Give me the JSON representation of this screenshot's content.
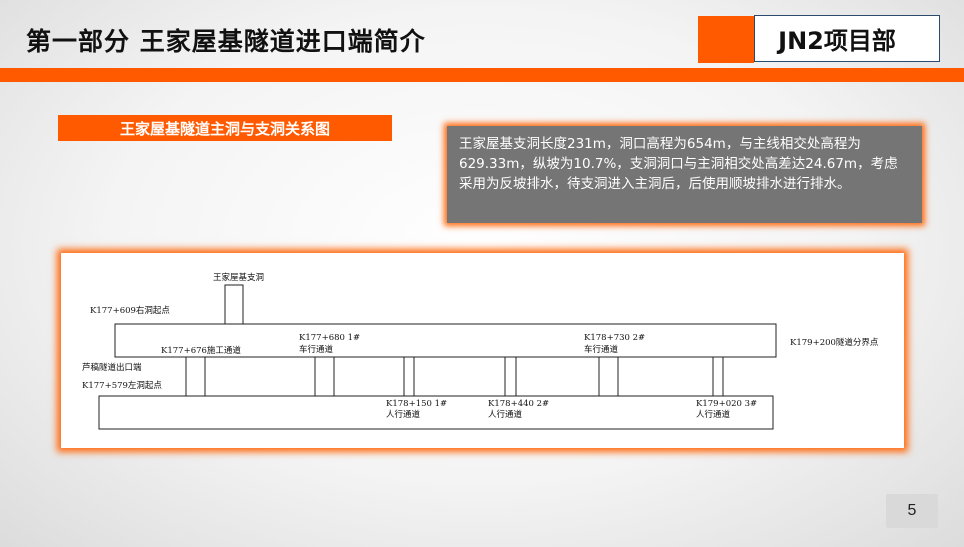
{
  "header": {
    "title": "第一部分  王家屋基隧道进口端简介",
    "project": "JN2项目部"
  },
  "section_label": "王家屋基隧道主洞与支洞关系图",
  "info_text": "王家屋基支洞长度231m，洞口高程为654m，与主线相交处高程为629.33m，纵坡为10.7%，支洞洞口与主洞相交处高差达24.67m，考虑采用为反坡排水，待支洞进入主洞后，后使用顺坡排水进行排水。",
  "diagram": {
    "branch_tunnel": "王家屋基支洞",
    "right_portal_start": "K177+609右洞起点",
    "construction_passage": "K177+676施工通道",
    "exit_end": "芦稿隧道出口端",
    "left_portal_start": "K177+579左洞起点",
    "boundary": "K179+200隧道分界点",
    "vehicle_passages": [
      {
        "station": "K177+680 1#",
        "label": "车行通道"
      },
      {
        "station": "K178+730 2#",
        "label": "车行通道"
      }
    ],
    "pedestrian_passages": [
      {
        "station": "K178+150 1#",
        "label": "人行通道"
      },
      {
        "station": "K178+440 2#",
        "label": "人行通道"
      },
      {
        "station": "K179+020 3#",
        "label": "人行通道"
      }
    ]
  },
  "page_number": "5",
  "colors": {
    "accent": "#ff5a00",
    "info_bg": "#757575"
  }
}
